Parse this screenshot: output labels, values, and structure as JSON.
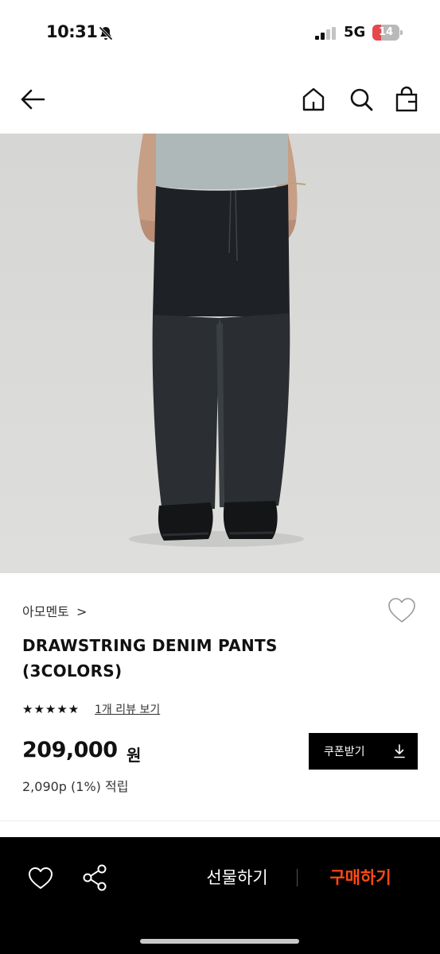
{
  "status_bar": {
    "time": "10:31",
    "network": "5G",
    "battery_level": "14",
    "battery_fraction": 0.14,
    "icons": [
      "bell-slash-icon",
      "signal-icon",
      "battery-icon"
    ]
  },
  "nav": {
    "icons": [
      "back-arrow-icon",
      "home-icon",
      "search-icon",
      "shopping-bag-icon"
    ]
  },
  "product": {
    "brand": "아모멘토",
    "brand_chevron": ">",
    "title_line1": "DRAWSTRING DENIM PANTS",
    "title_line2": "(3COLORS)",
    "rating": 5,
    "rating_stars": "★★★★★",
    "review_link": "1개 리뷰 보기",
    "price": "209,000",
    "price_unit": "원",
    "points": "2,090p (1%) 적립",
    "coupon_button": "쿠폰받기"
  },
  "bottom_bar": {
    "gift_label": "선물하기",
    "buy_label": "구매하기"
  },
  "colors": {
    "accent_buy": "#ff4a14",
    "bottom_bar_bg": "#000000",
    "battery_low": "#e5484d"
  }
}
